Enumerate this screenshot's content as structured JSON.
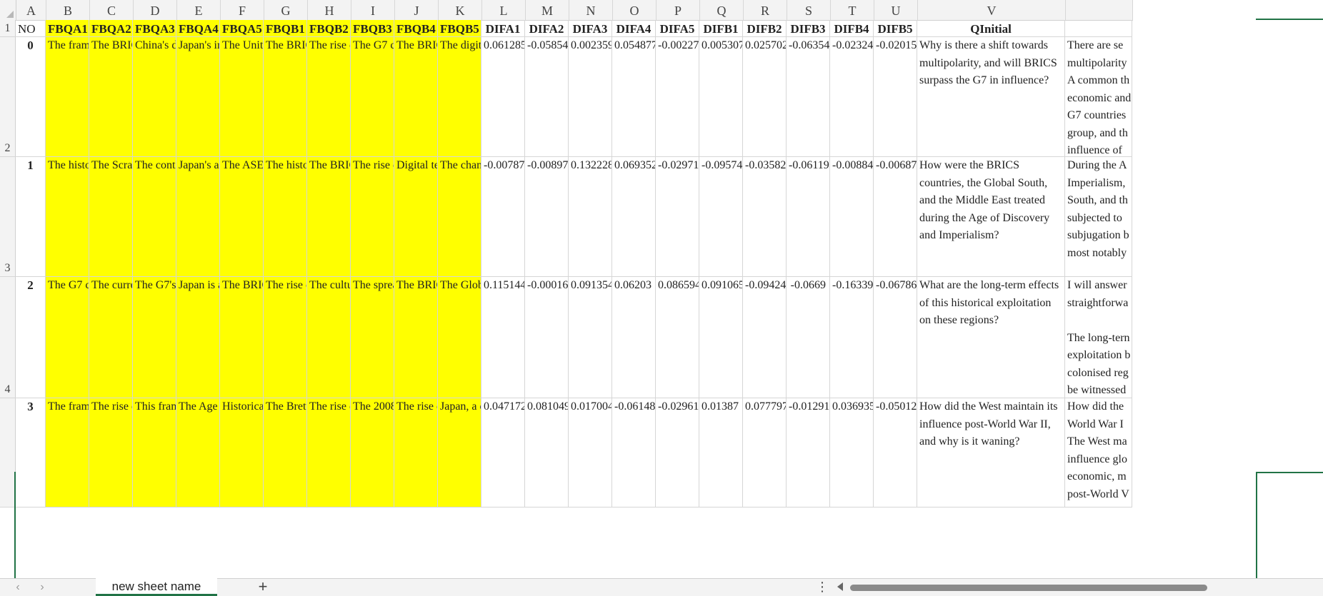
{
  "columns": [
    "A",
    "B",
    "C",
    "D",
    "E",
    "F",
    "G",
    "H",
    "I",
    "J",
    "K",
    "L",
    "M",
    "N",
    "O",
    "P",
    "Q",
    "R",
    "S",
    "T",
    "U",
    "V",
    ""
  ],
  "row_numbers": [
    "1",
    "2",
    "3",
    "4",
    ""
  ],
  "header_cells": [
    "NO",
    "FBQA1",
    "FBQA2",
    "FBQA3",
    "FBQA4",
    "FBQA5",
    "FBQB1",
    "FBQB2",
    "FBQB3",
    "FBQB4",
    "FBQB5",
    "DIFA1",
    "DIFA2",
    "DIFA3",
    "DIFA4",
    "DIFA5",
    "DIFB1",
    "DIFB2",
    "DIFB3",
    "DIFB4",
    "DIFB5",
    "QInitial",
    ""
  ],
  "rows": [
    {
      "no": "0",
      "fb": [
        "The frame",
        "The BRIC",
        "China's dc",
        "Japan's in",
        "The Unite",
        "The BRIC",
        "The rise c",
        "The G7 cc",
        "The BRIC",
        "The digita"
      ],
      "dif": [
        "0.061285",
        "-0.05854",
        "0.002359",
        "0.054877",
        "-0.00227",
        "0.005307",
        "0.025702",
        "-0.06354",
        "-0.02324",
        "-0.02015"
      ],
      "qinitial": "Why is there a shift towards multipolarity, and will BRICS surpass the G7 in influence?",
      "next": "There are se\nmultipolarity\nA common th\neconomic and\nG7 countries\ngroup, and th\ninfluence of \ninternal dysf"
    },
    {
      "no": "1",
      "fb": [
        "The histor",
        "The Scran",
        "The contin",
        "Japan's al",
        "The ASEA",
        "The histor",
        "The BRIC",
        "The rise c",
        "Digital tec",
        "The chang"
      ],
      "dif": [
        "-0.00787",
        "-0.00897",
        "0.132228",
        "0.069352",
        "-0.02971",
        "-0.09574",
        "-0.03582",
        "-0.06119",
        "-0.00884",
        "-0.00687"
      ],
      "qinitial": "How were the BRICS countries, the Global South, and the Middle East treated during the Age of Discovery and Imperialism?",
      "next": "During the A\nImperialism,\nSouth, and th\nsubjected to \nsubjugation b\nmost notably\n\nThe expansic"
    },
    {
      "no": "2",
      "fb": [
        "The G7 cc",
        "The curre",
        "The G7's i",
        "Japan is a",
        "The BRIC",
        "The rise c",
        "The cultu",
        "The sprea",
        "The BRIC",
        "The Globa"
      ],
      "dif": [
        "0.115144",
        "-0.00016",
        "0.091354",
        "0.06203",
        "0.086594",
        "0.091065",
        "-0.09424",
        "-0.0669",
        "-0.16339",
        "-0.06786"
      ],
      "qinitial": "What are the long-term effects of this historical exploitation on these regions?",
      "next": "I will answer\nstraightforwa\n\nThe long-tern\nexploitation b\ncolonised reg\nbe witnessed"
    },
    {
      "no": "3",
      "fb": [
        "The frame",
        "The rise c",
        "This fram",
        "The Age c",
        "Historical",
        "The Brett",
        "The rise c",
        "The 2008",
        "The rise c",
        "Japan, a c"
      ],
      "dif": [
        "0.047172",
        "0.081049",
        "0.017004",
        "-0.06148",
        "-0.02961",
        "0.01387",
        "0.077797",
        "-0.01291",
        "0.036935",
        "-0.05012"
      ],
      "qinitial": "How did the West maintain its influence post-World War II, and why is it waning?",
      "next": "How did the \nWorld War I\nThe West ma\ninfluence glo\neconomic, m\npost-World V"
    }
  ],
  "sheet_tab": "new sheet name",
  "accent": "#217346",
  "highlight": "#ffff00"
}
